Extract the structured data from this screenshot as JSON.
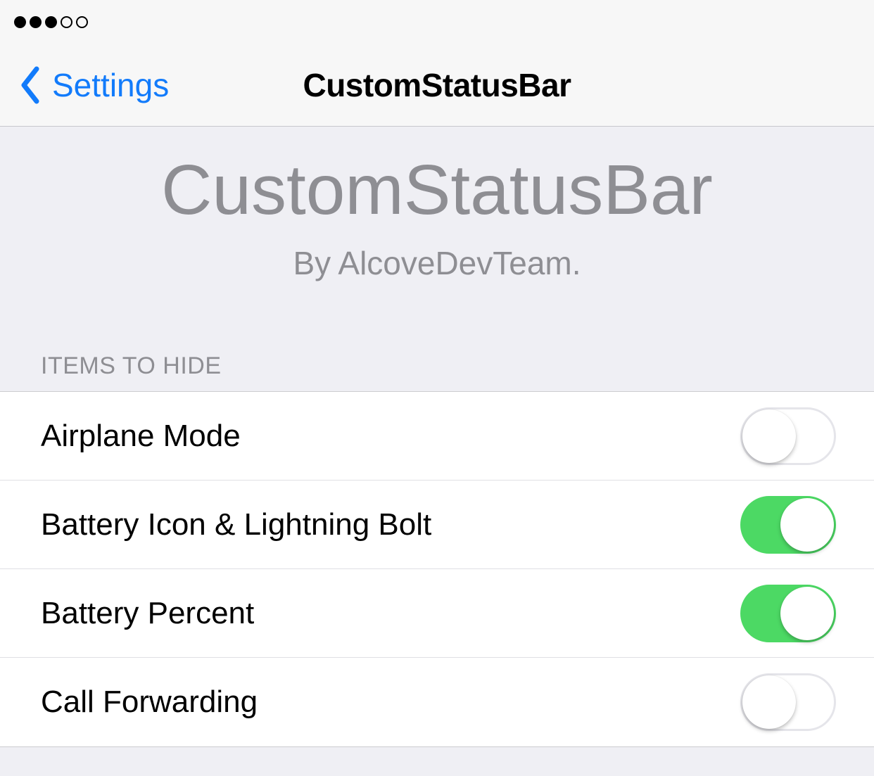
{
  "statusbar": {
    "signal_strength": 3,
    "signal_max": 5
  },
  "nav": {
    "back_label": "Settings",
    "title": "CustomStatusBar"
  },
  "header": {
    "title": "CustomStatusBar",
    "subtitle": "By AlcoveDevTeam."
  },
  "section_header": "Items to hide",
  "items": [
    {
      "label": "Airplane Mode",
      "on": false
    },
    {
      "label": "Battery Icon & Lightning Bolt",
      "on": true
    },
    {
      "label": "Battery Percent",
      "on": true
    },
    {
      "label": "Call Forwarding",
      "on": false
    }
  ],
  "colors": {
    "accent": "#127bfb",
    "switch_on": "#4cd964"
  }
}
